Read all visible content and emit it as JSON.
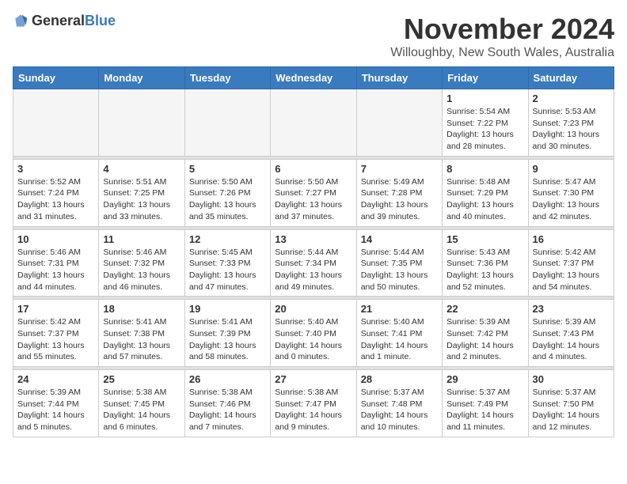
{
  "header": {
    "logo_general": "General",
    "logo_blue": "Blue",
    "month_title": "November 2024",
    "location": "Willoughby, New South Wales, Australia"
  },
  "weekdays": [
    "Sunday",
    "Monday",
    "Tuesday",
    "Wednesday",
    "Thursday",
    "Friday",
    "Saturday"
  ],
  "weeks": [
    [
      {
        "day": "",
        "empty": true
      },
      {
        "day": "",
        "empty": true
      },
      {
        "day": "",
        "empty": true
      },
      {
        "day": "",
        "empty": true
      },
      {
        "day": "",
        "empty": true
      },
      {
        "day": "1",
        "sunrise": "5:54 AM",
        "sunset": "7:22 PM",
        "daylight": "13 hours and 28 minutes."
      },
      {
        "day": "2",
        "sunrise": "5:53 AM",
        "sunset": "7:23 PM",
        "daylight": "13 hours and 30 minutes."
      }
    ],
    [
      {
        "day": "3",
        "sunrise": "5:52 AM",
        "sunset": "7:24 PM",
        "daylight": "13 hours and 31 minutes."
      },
      {
        "day": "4",
        "sunrise": "5:51 AM",
        "sunset": "7:25 PM",
        "daylight": "13 hours and 33 minutes."
      },
      {
        "day": "5",
        "sunrise": "5:50 AM",
        "sunset": "7:26 PM",
        "daylight": "13 hours and 35 minutes."
      },
      {
        "day": "6",
        "sunrise": "5:50 AM",
        "sunset": "7:27 PM",
        "daylight": "13 hours and 37 minutes."
      },
      {
        "day": "7",
        "sunrise": "5:49 AM",
        "sunset": "7:28 PM",
        "daylight": "13 hours and 39 minutes."
      },
      {
        "day": "8",
        "sunrise": "5:48 AM",
        "sunset": "7:29 PM",
        "daylight": "13 hours and 40 minutes."
      },
      {
        "day": "9",
        "sunrise": "5:47 AM",
        "sunset": "7:30 PM",
        "daylight": "13 hours and 42 minutes."
      }
    ],
    [
      {
        "day": "10",
        "sunrise": "5:46 AM",
        "sunset": "7:31 PM",
        "daylight": "13 hours and 44 minutes."
      },
      {
        "day": "11",
        "sunrise": "5:46 AM",
        "sunset": "7:32 PM",
        "daylight": "13 hours and 46 minutes."
      },
      {
        "day": "12",
        "sunrise": "5:45 AM",
        "sunset": "7:33 PM",
        "daylight": "13 hours and 47 minutes."
      },
      {
        "day": "13",
        "sunrise": "5:44 AM",
        "sunset": "7:34 PM",
        "daylight": "13 hours and 49 minutes."
      },
      {
        "day": "14",
        "sunrise": "5:44 AM",
        "sunset": "7:35 PM",
        "daylight": "13 hours and 50 minutes."
      },
      {
        "day": "15",
        "sunrise": "5:43 AM",
        "sunset": "7:36 PM",
        "daylight": "13 hours and 52 minutes."
      },
      {
        "day": "16",
        "sunrise": "5:42 AM",
        "sunset": "7:37 PM",
        "daylight": "13 hours and 54 minutes."
      }
    ],
    [
      {
        "day": "17",
        "sunrise": "5:42 AM",
        "sunset": "7:37 PM",
        "daylight": "13 hours and 55 minutes."
      },
      {
        "day": "18",
        "sunrise": "5:41 AM",
        "sunset": "7:38 PM",
        "daylight": "13 hours and 57 minutes."
      },
      {
        "day": "19",
        "sunrise": "5:41 AM",
        "sunset": "7:39 PM",
        "daylight": "13 hours and 58 minutes."
      },
      {
        "day": "20",
        "sunrise": "5:40 AM",
        "sunset": "7:40 PM",
        "daylight": "14 hours and 0 minutes."
      },
      {
        "day": "21",
        "sunrise": "5:40 AM",
        "sunset": "7:41 PM",
        "daylight": "14 hours and 1 minute."
      },
      {
        "day": "22",
        "sunrise": "5:39 AM",
        "sunset": "7:42 PM",
        "daylight": "14 hours and 2 minutes."
      },
      {
        "day": "23",
        "sunrise": "5:39 AM",
        "sunset": "7:43 PM",
        "daylight": "14 hours and 4 minutes."
      }
    ],
    [
      {
        "day": "24",
        "sunrise": "5:39 AM",
        "sunset": "7:44 PM",
        "daylight": "14 hours and 5 minutes."
      },
      {
        "day": "25",
        "sunrise": "5:38 AM",
        "sunset": "7:45 PM",
        "daylight": "14 hours and 6 minutes."
      },
      {
        "day": "26",
        "sunrise": "5:38 AM",
        "sunset": "7:46 PM",
        "daylight": "14 hours and 7 minutes."
      },
      {
        "day": "27",
        "sunrise": "5:38 AM",
        "sunset": "7:47 PM",
        "daylight": "14 hours and 9 minutes."
      },
      {
        "day": "28",
        "sunrise": "5:37 AM",
        "sunset": "7:48 PM",
        "daylight": "14 hours and 10 minutes."
      },
      {
        "day": "29",
        "sunrise": "5:37 AM",
        "sunset": "7:49 PM",
        "daylight": "14 hours and 11 minutes."
      },
      {
        "day": "30",
        "sunrise": "5:37 AM",
        "sunset": "7:50 PM",
        "daylight": "14 hours and 12 minutes."
      }
    ]
  ]
}
